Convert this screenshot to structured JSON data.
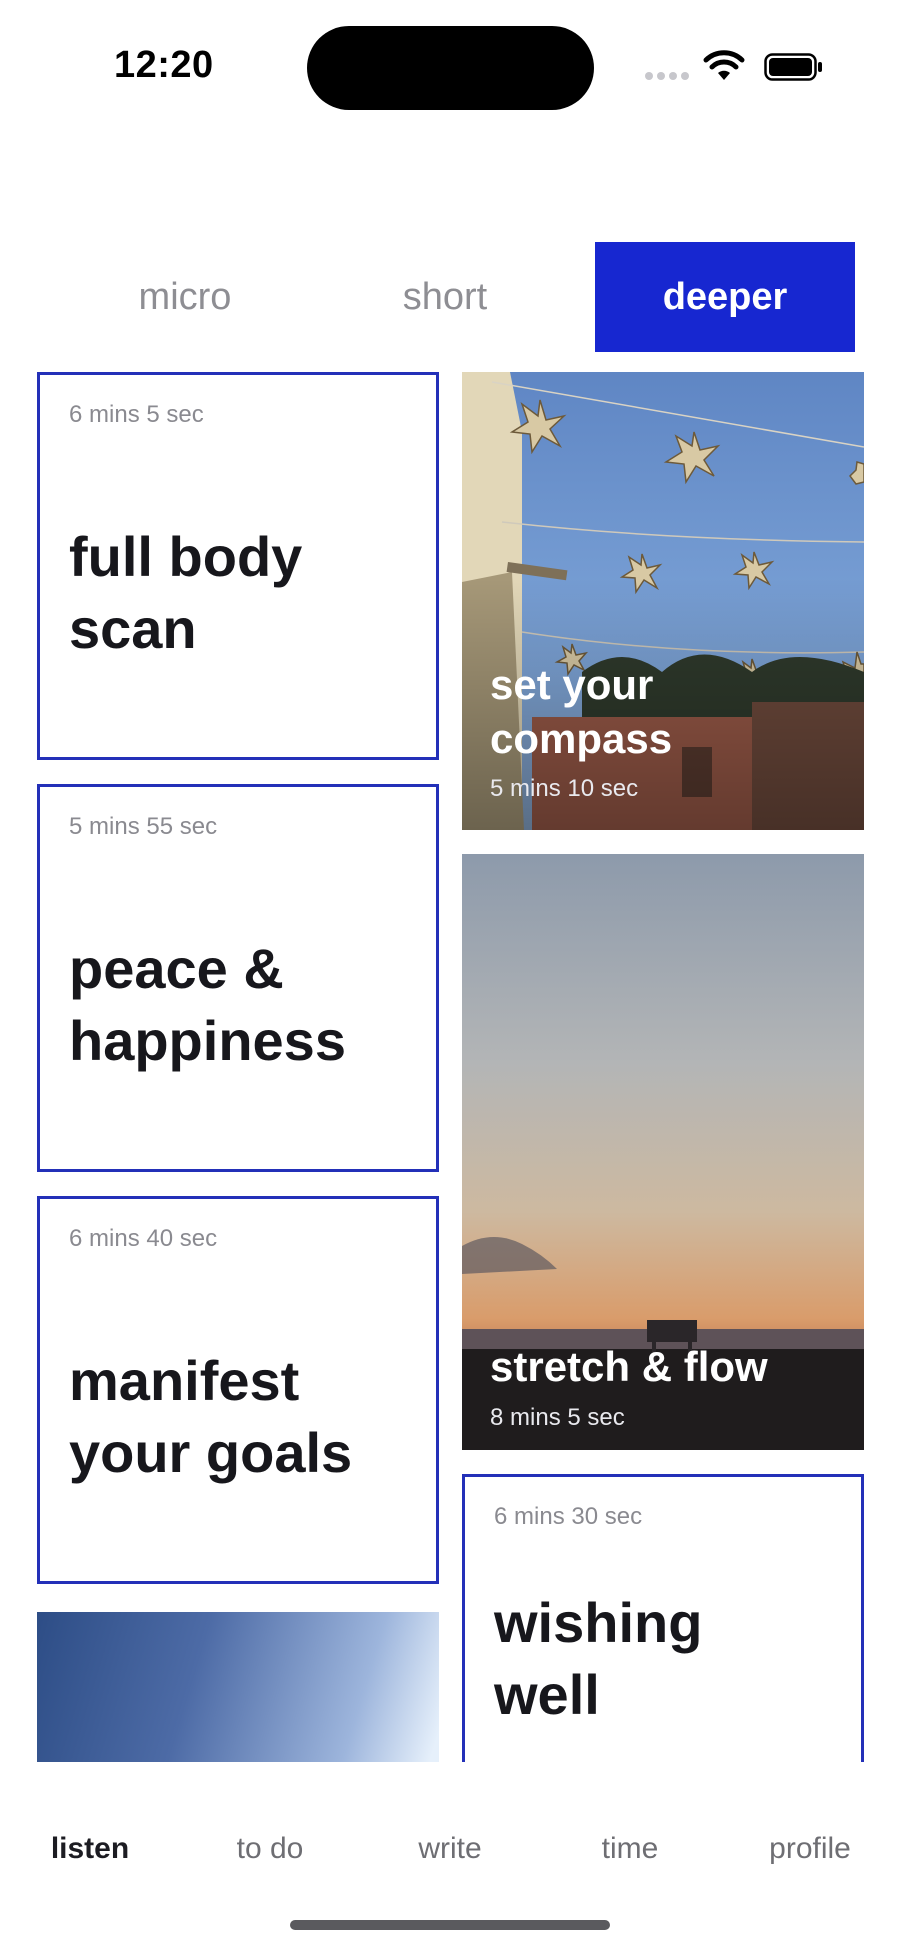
{
  "status_bar": {
    "time": "12:20"
  },
  "tabs": [
    {
      "label": "micro",
      "active": false
    },
    {
      "label": "short",
      "active": false
    },
    {
      "label": "deeper",
      "active": true
    }
  ],
  "accent_color": "#1727d0",
  "card_border_color": "#2330b8",
  "sessions": [
    {
      "title_line1": "full body",
      "title_line2": "scan",
      "duration": "6 mins 5 sec",
      "style": "outlined"
    },
    {
      "title_line1": "set your",
      "title_line2": "compass",
      "duration": "5 mins 10 sec",
      "style": "photo",
      "photo": "sky-with-hanging-stars"
    },
    {
      "title_line1": "peace &",
      "title_line2": "happiness",
      "duration": "5 mins 55 sec",
      "style": "outlined"
    },
    {
      "title_line1": "stretch & flow",
      "duration": "8 mins 5 sec",
      "style": "photo",
      "photo": "beach-sunset-lifeguard-tower"
    },
    {
      "title_line1": "manifest",
      "title_line2": "your goals",
      "duration": "6 mins 40 sec",
      "style": "outlined"
    },
    {
      "title_line1": "wishing",
      "title_line2": "well",
      "duration": "6 mins 30 sec",
      "style": "outlined"
    },
    {
      "style": "photo",
      "photo": "blue-gradient-sky"
    }
  ],
  "bottom_nav": [
    {
      "label": "listen",
      "active": true
    },
    {
      "label": "to do",
      "active": false
    },
    {
      "label": "write",
      "active": false
    },
    {
      "label": "time",
      "active": false
    },
    {
      "label": "profile",
      "active": false
    }
  ]
}
